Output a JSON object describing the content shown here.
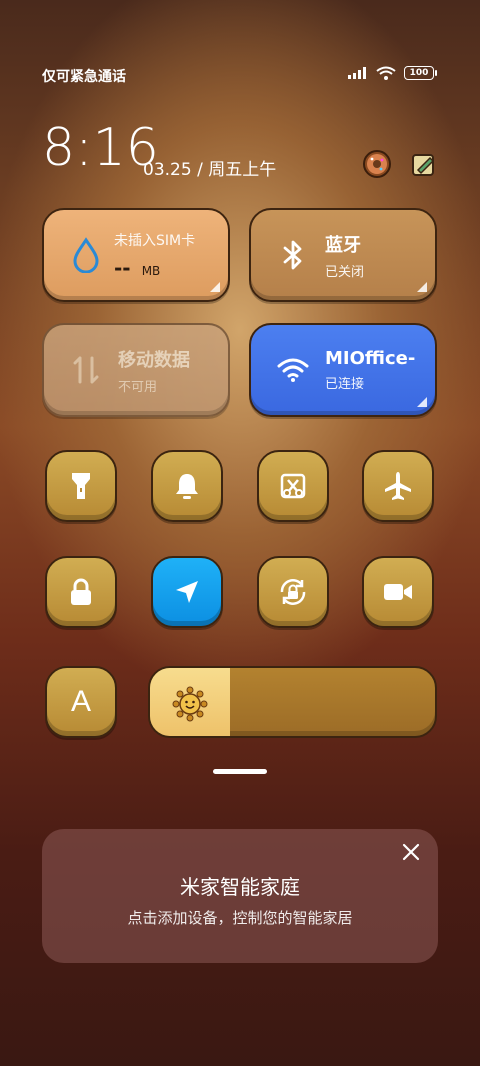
{
  "status_bar": {
    "carrier_text": "仅可紧急通话",
    "battery": "100"
  },
  "clock": {
    "time": "8:16",
    "date": "03.25",
    "separator": "/",
    "weekday": "周五上午"
  },
  "tiles": {
    "data": {
      "label": "未插入SIM卡",
      "value": "--",
      "unit": "MB"
    },
    "bluetooth": {
      "title": "蓝牙",
      "status": "已关闭"
    },
    "mobile_data": {
      "title": "移动数据",
      "status": "不可用"
    },
    "wifi": {
      "title": "MIOffice-",
      "status": "已连接"
    }
  },
  "toggles": {
    "row1": [
      "flashlight-icon",
      "bell-icon",
      "screenshot-icon",
      "airplane-icon"
    ],
    "row2": [
      "lock-icon",
      "location-icon",
      "rotation-lock-icon",
      "video-icon"
    ]
  },
  "brightness": {
    "auto_label": "A",
    "level": 0.28
  },
  "home_card": {
    "title": "米家智能家庭",
    "subtitle": "点击添加设备，控制您的智能家居"
  },
  "colors": {
    "accent_blue": "#3f73e6",
    "location_blue": "#1aa0f0",
    "button_gold": "#c79c44",
    "data_tile": "#e6a56a"
  }
}
